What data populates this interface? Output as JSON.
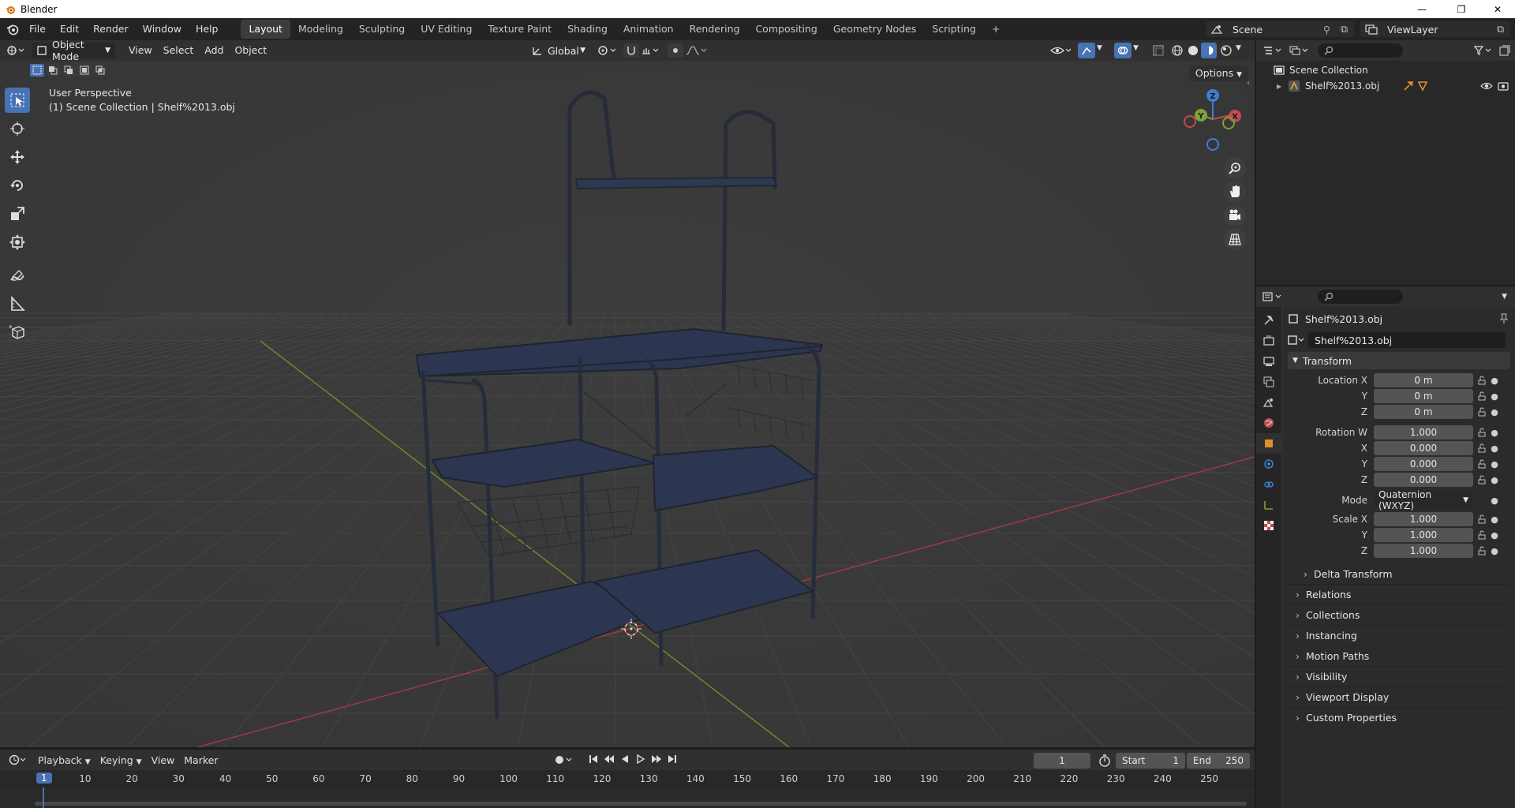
{
  "app": {
    "title": "Blender"
  },
  "window_controls": {
    "minimize": "—",
    "restore": "❐",
    "close": "✕"
  },
  "menu": [
    "File",
    "Edit",
    "Render",
    "Window",
    "Help"
  ],
  "workspaces": [
    "Layout",
    "Modeling",
    "Sculpting",
    "UV Editing",
    "Texture Paint",
    "Shading",
    "Animation",
    "Rendering",
    "Compositing",
    "Geometry Nodes",
    "Scripting"
  ],
  "workspace_add": "+",
  "scene": {
    "name": "Scene",
    "view_layer": "ViewLayer"
  },
  "viewport_header": {
    "mode": "Object Mode",
    "menus": [
      "View",
      "Select",
      "Add",
      "Object"
    ],
    "orientation": "Global",
    "options": "Options"
  },
  "viewport": {
    "perspective": "User Perspective",
    "collection_info": "(1) Scene Collection | Shelf%2013.obj"
  },
  "gizmo": {
    "x": "X",
    "y": "Y",
    "z": "Z"
  },
  "outliner": {
    "collection": "Scene Collection",
    "object": "Shelf%2013.obj"
  },
  "properties": {
    "object_name": "Shelf%2013.obj",
    "data_name": "Shelf%2013.obj",
    "transform": {
      "title": "Transform",
      "location_label": "Location X",
      "location": {
        "x": "0 m",
        "y": "0 m",
        "z": "0 m"
      },
      "rotation_label": "Rotation W",
      "rotation": {
        "w": "1.000",
        "x": "0.000",
        "y": "0.000",
        "z": "0.000"
      },
      "mode_label": "Mode",
      "mode": "Quaternion (WXYZ)",
      "scale_label": "Scale X",
      "scale": {
        "x": "1.000",
        "y": "1.000",
        "z": "1.000"
      },
      "y_label": "Y",
      "z_label": "Z",
      "x_label": "X",
      "delta": "Delta Transform"
    },
    "panels": [
      "Relations",
      "Collections",
      "Instancing",
      "Motion Paths",
      "Visibility",
      "Viewport Display",
      "Custom Properties"
    ]
  },
  "timeline": {
    "menus": [
      "Playback",
      "Keying",
      "View",
      "Marker"
    ],
    "current_frame": "1",
    "start_label": "Start",
    "start": "1",
    "end_label": "End",
    "end": "250",
    "ticks": [
      "1",
      "10",
      "20",
      "30",
      "40",
      "50",
      "60",
      "70",
      "80",
      "90",
      "100",
      "110",
      "120",
      "130",
      "140",
      "150",
      "160",
      "170",
      "180",
      "190",
      "200",
      "210",
      "220",
      "230",
      "240",
      "250"
    ]
  },
  "colors": {
    "accent": "#4772b3",
    "x_axis": "#c24b52",
    "y_axis": "#7ea13a",
    "z_axis": "#3d7fd1",
    "shelf": "#2c3548"
  }
}
